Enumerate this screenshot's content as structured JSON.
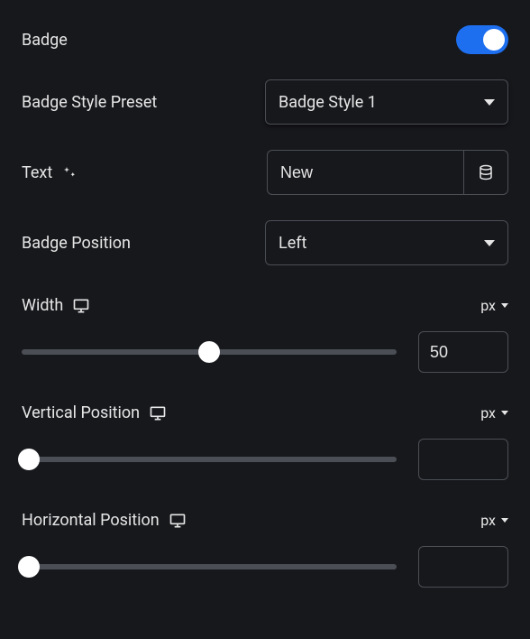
{
  "badge": {
    "label": "Badge",
    "enabled": true
  },
  "stylePreset": {
    "label": "Badge Style Preset",
    "selected": "Badge Style 1"
  },
  "text": {
    "label": "Text",
    "value": "New"
  },
  "position": {
    "label": "Badge Position",
    "selected": "Left"
  },
  "width": {
    "label": "Width",
    "unit": "px",
    "value": "50",
    "percent": 50
  },
  "vertical": {
    "label": "Vertical Position",
    "unit": "px",
    "value": "",
    "percent": 0
  },
  "horizontal": {
    "label": "Horizontal Position",
    "unit": "px",
    "value": "",
    "percent": 0
  }
}
